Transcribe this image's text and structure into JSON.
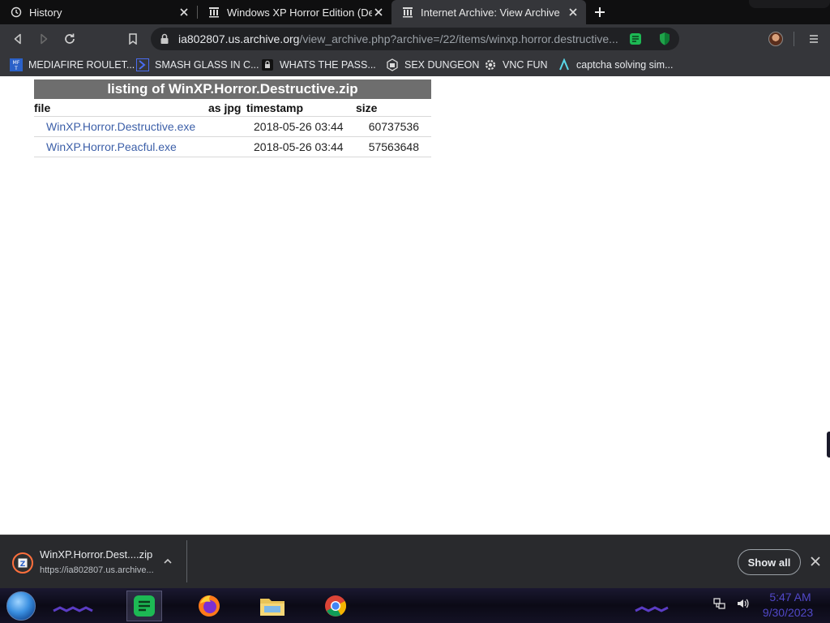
{
  "tabs": [
    {
      "title": "History",
      "icon": "history-icon",
      "active": false
    },
    {
      "title": "Windows XP Horror Edition (Destructive",
      "icon": "archive-pillar-icon",
      "active": false
    },
    {
      "title": "Internet Archive: View Archive",
      "icon": "archive-pillar-icon",
      "active": true
    }
  ],
  "toolbar": {
    "url_host": "ia802807.us.archive.org",
    "url_path": "/view_archive.php?archive=/22/items/winxp.horror.destructive..."
  },
  "bookmarks": [
    {
      "label": "MEDIAFIRE ROULET...",
      "icon": "mediafire-icon"
    },
    {
      "label": "SMASH GLASS IN C...",
      "icon": "chevron-logo-icon"
    },
    {
      "label": "WHATS THE PASS...",
      "icon": "lock-box-icon"
    },
    {
      "label": "SEX DUNGEON",
      "icon": "dungeon-icon"
    },
    {
      "label": "VNC FUN",
      "icon": "gear-cog-icon"
    },
    {
      "label": "captcha solving sim...",
      "icon": "a-logo-icon"
    }
  ],
  "page": {
    "listing_title": "listing of WinXP.Horror.Destructive.zip",
    "columns": {
      "file": "file",
      "as_jpg": "as jpg",
      "timestamp": "timestamp",
      "size": "size"
    },
    "rows": [
      {
        "file": "WinXP.Horror.Destructive.exe",
        "timestamp": "2018-05-26 03:44",
        "size": "60737536"
      },
      {
        "file": "WinXP.Horror.Peacful.exe",
        "timestamp": "2018-05-26 03:44",
        "size": "57563648"
      }
    ]
  },
  "download": {
    "filename": "WinXP.Horror.Dest....zip",
    "url": "https://ia802807.us.archive...",
    "show_all": "Show all"
  },
  "taskbar": {
    "apps": [
      "notes-app-icon",
      "firefox-icon",
      "file-explorer-icon",
      "chrome-icon"
    ],
    "time": "5:47 AM",
    "date": "9/30/2023"
  },
  "colors": {
    "tab_strip": "#0f0f10",
    "toolbar": "#35363a",
    "link": "#3c5fa8",
    "listing_header": "#6e6e6e",
    "clock": "#5148c8"
  }
}
